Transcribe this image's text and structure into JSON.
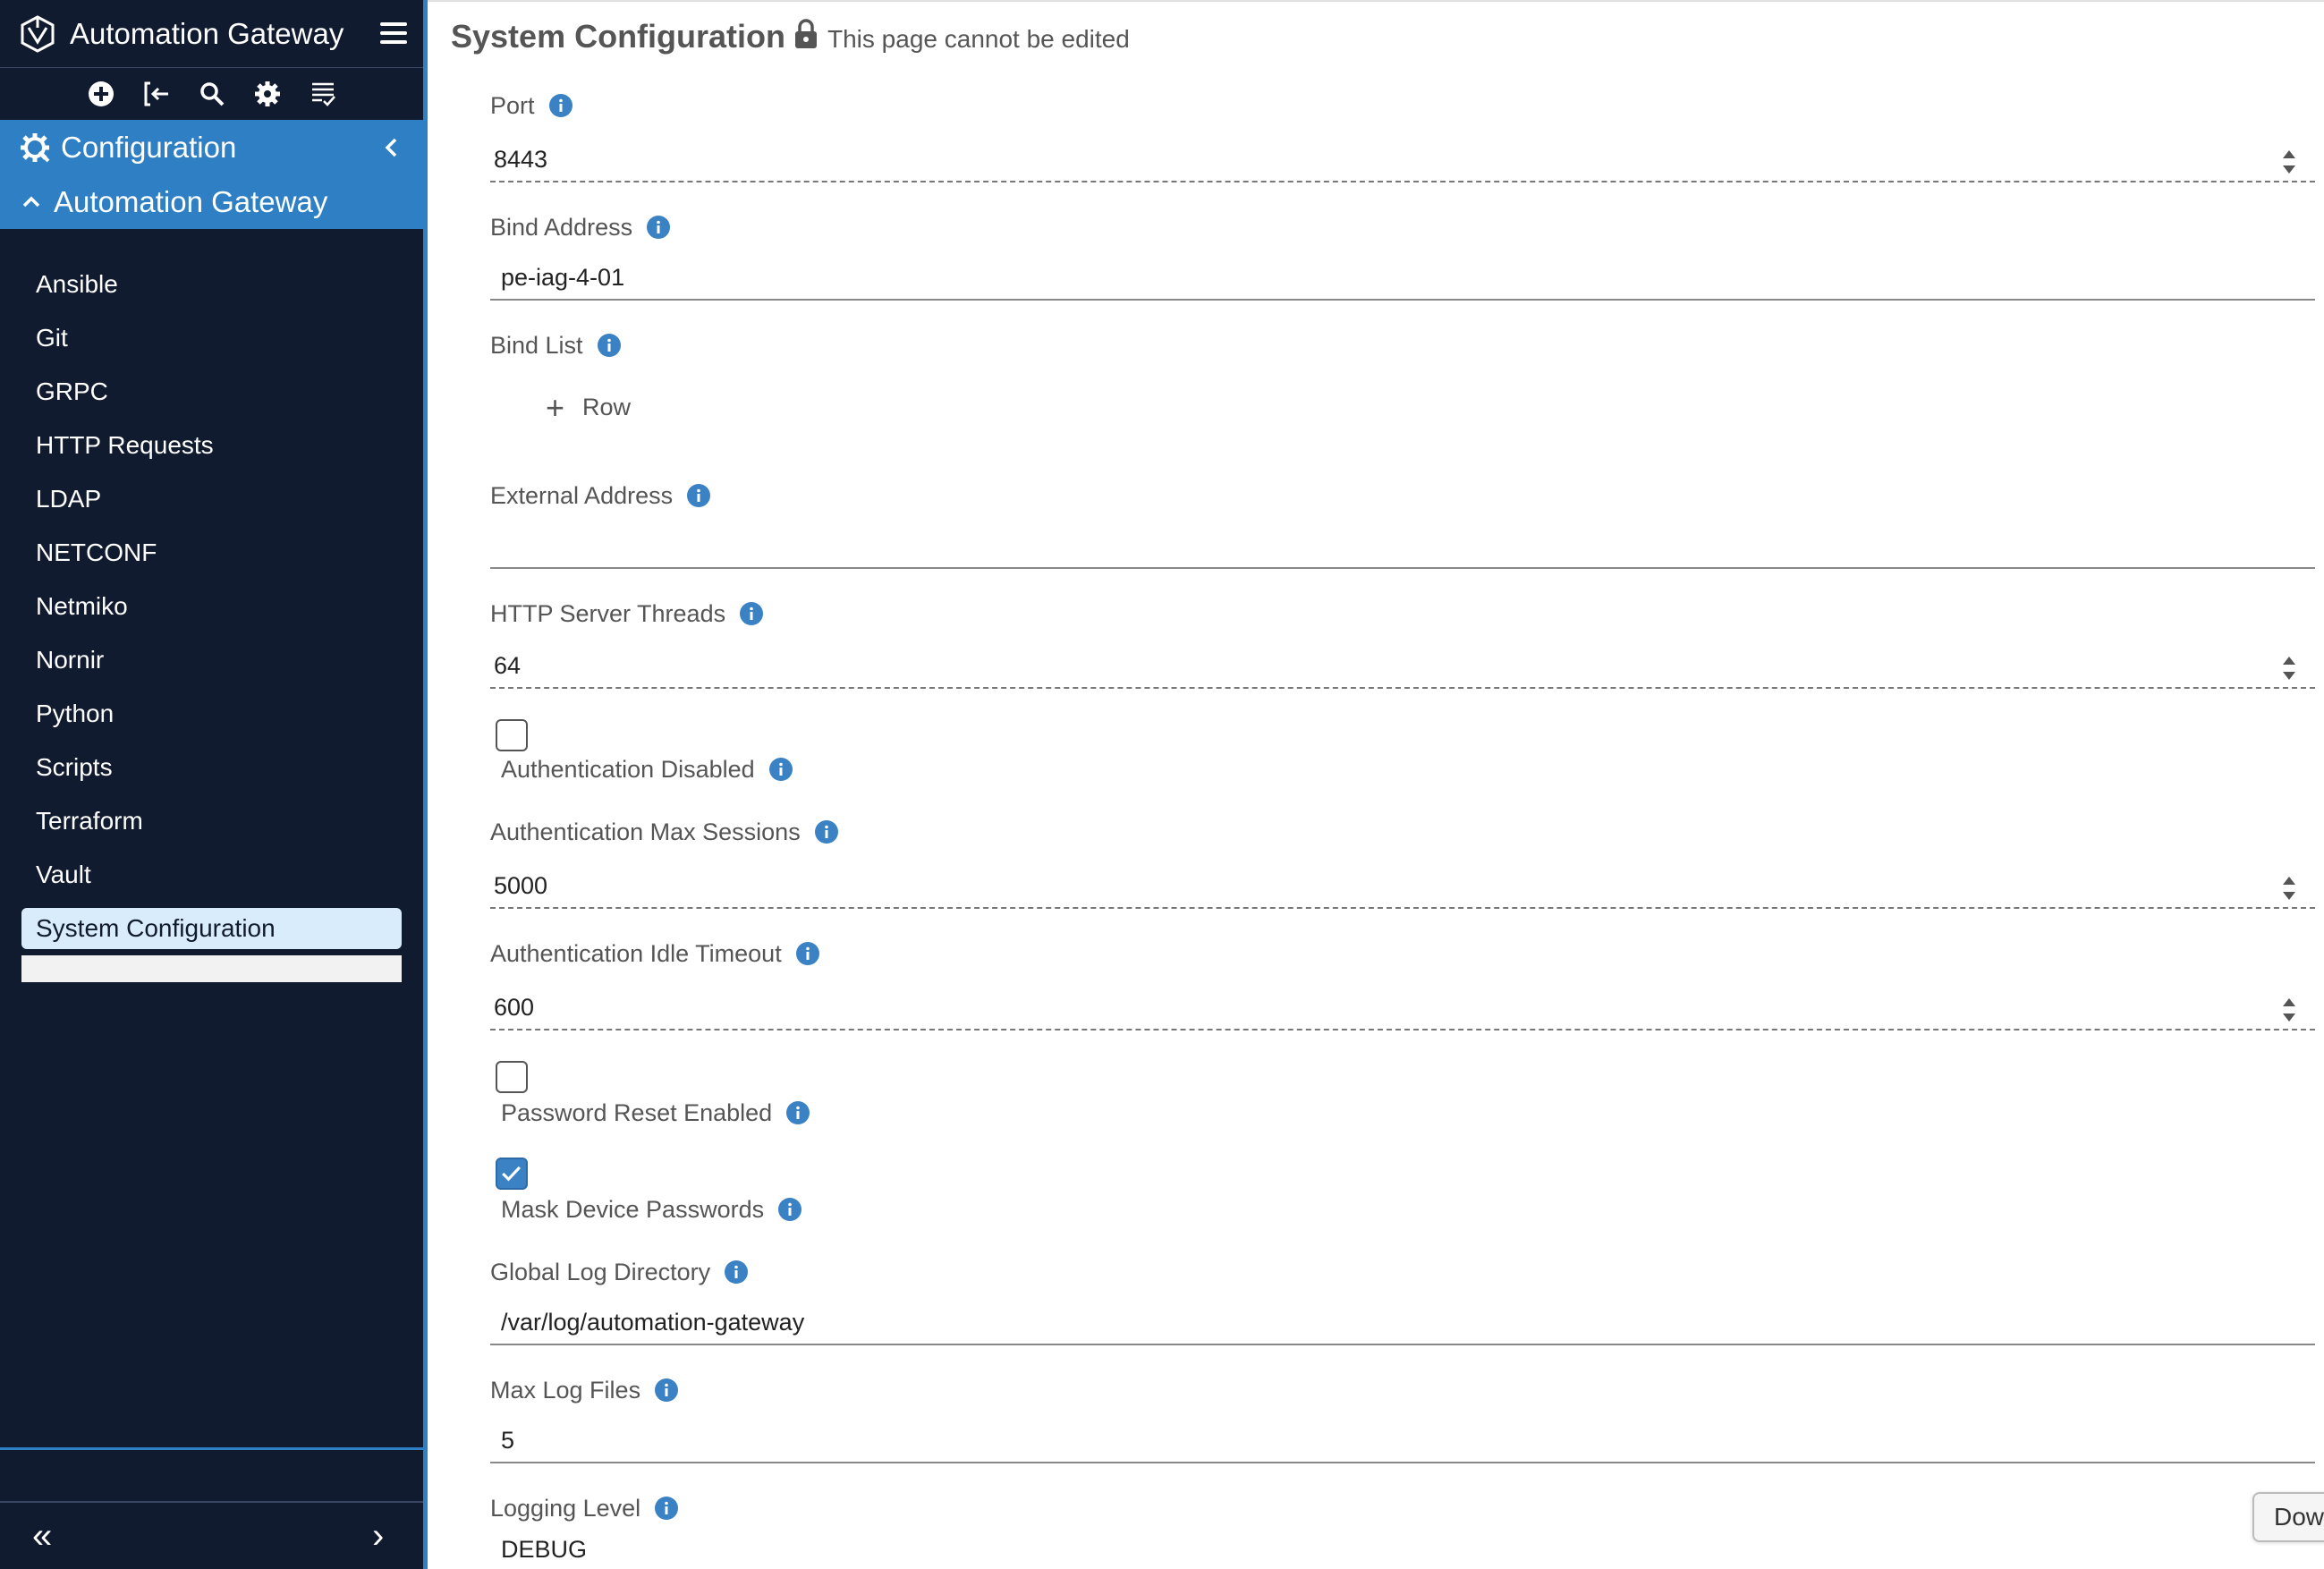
{
  "app": {
    "title": "Automation Gateway"
  },
  "sidebar": {
    "section": "Configuration",
    "subsection": "Automation Gateway",
    "items": [
      {
        "label": "Ansible"
      },
      {
        "label": "Git"
      },
      {
        "label": "GRPC"
      },
      {
        "label": "HTTP Requests"
      },
      {
        "label": "LDAP"
      },
      {
        "label": "NETCONF"
      },
      {
        "label": "Netmiko"
      },
      {
        "label": "Nornir"
      },
      {
        "label": "Python"
      },
      {
        "label": "Scripts"
      },
      {
        "label": "Terraform"
      },
      {
        "label": "Vault"
      },
      {
        "label": "System Configuration",
        "active": true
      }
    ],
    "toolbar_icons": [
      "add-icon",
      "import-icon",
      "search-icon",
      "gear-icon",
      "list-check-icon"
    ],
    "footer_left": "«",
    "footer_right": "›"
  },
  "main": {
    "title": "System Configuration",
    "lock_text": "This page cannot be edited",
    "fields": {
      "port": {
        "label": "Port",
        "value": "8443"
      },
      "bind_address": {
        "label": "Bind Address",
        "value": "pe-iag-4-01"
      },
      "bind_list": {
        "label": "Bind List",
        "add_label": "Row"
      },
      "external_address": {
        "label": "External Address",
        "value": ""
      },
      "http_threads": {
        "label": "HTTP Server Threads",
        "value": "64"
      },
      "auth_disabled": {
        "label": "Authentication Disabled",
        "checked": false
      },
      "auth_max_sessions": {
        "label": "Authentication Max Sessions",
        "value": "5000"
      },
      "auth_idle_timeout": {
        "label": "Authentication Idle Timeout",
        "value": "600"
      },
      "password_reset": {
        "label": "Password Reset Enabled",
        "checked": false
      },
      "mask_passwords": {
        "label": "Mask Device Passwords",
        "checked": true
      },
      "log_dir": {
        "label": "Global Log Directory",
        "value": "/var/log/automation-gateway"
      },
      "max_log_files": {
        "label": "Max Log Files",
        "value": "5"
      },
      "logging_level": {
        "label": "Logging Level",
        "value": "DEBUG"
      }
    },
    "download_label": "Dow"
  },
  "colors": {
    "sidebar_bg": "#111b30",
    "accent": "#2f7fc5",
    "active_item_bg": "#d9ecfb",
    "info_icon": "#3a82c4"
  }
}
